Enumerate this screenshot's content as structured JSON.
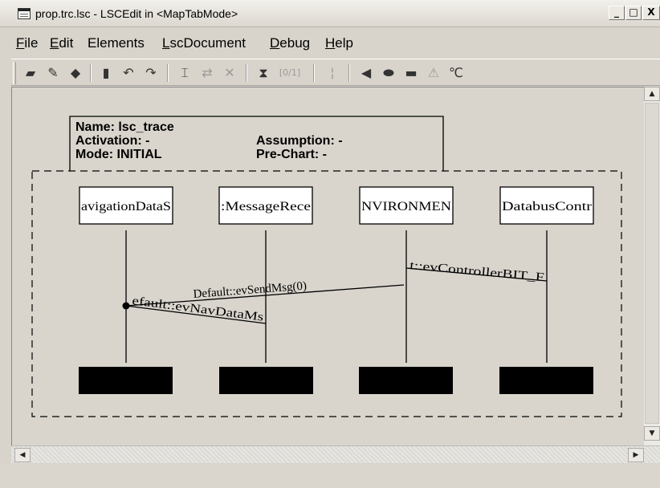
{
  "window": {
    "title": "prop.trc.lsc - LSCEdit in <MapTabMode>",
    "controls": {
      "minimize": "_",
      "maximize": "□",
      "close": "X"
    }
  },
  "menu": [
    {
      "first": "F",
      "rest": "ile"
    },
    {
      "first": "E",
      "rest": "dit"
    },
    {
      "first": "",
      "rest": "Elements"
    },
    {
      "first": "L",
      "rest": "scDocument"
    },
    {
      "first": "D",
      "rest": "ebug"
    },
    {
      "first": "H",
      "rest": "elp"
    }
  ],
  "toolbar_icons": [
    "selection-icon",
    "tag-icon",
    "diamond-icon",
    "clipboard-icon",
    "undo-icon",
    "redo-icon",
    "text-cursor-icon",
    "arrows-icon",
    "cut-icon",
    "hourglass-icon",
    "bracket-icon",
    "separator-icon",
    "left-arrow-shape-icon",
    "hexagon-shape-icon",
    "rectangle-shape-icon",
    "triangle-shape-icon",
    "celsius-icon"
  ],
  "toolbar_glyphs": [
    "▰",
    "✎",
    "◆",
    "▮",
    "↶",
    "↷",
    "⌶",
    "⇄",
    "✕",
    "⧗",
    "[0/1]",
    "¦",
    "◀",
    "⬬",
    "▬",
    "⚠",
    "℃"
  ],
  "chart_header": {
    "name_label": "Name: lsc_trace",
    "activation_label": "Activation: -",
    "mode_label": "Mode: INITIAL",
    "assumption_label": "Assumption: -",
    "prechart_label": "Pre-Chart: -"
  },
  "instances": [
    {
      "label": "avigationDataS"
    },
    {
      "label": ":MessageRece"
    },
    {
      "label": "NVIRONMEN"
    },
    {
      "label": "DatabusContr"
    }
  ],
  "messages": [
    {
      "label": "Default::evSendMsg(0)",
      "from": 2,
      "to": 0
    },
    {
      "label": "t::evControllerBIT_F",
      "from": 2,
      "to": 3
    },
    {
      "label": "efault::evNavDataMs",
      "from": 0,
      "to": 1
    }
  ],
  "scrollbar": {
    "up": "▲",
    "down": "▼",
    "left": "◀",
    "right": "▶"
  },
  "colors": {
    "background": "#d9d5cd",
    "instance_box": "#ffffff",
    "instance_end": "#000000",
    "line": "#000000"
  }
}
